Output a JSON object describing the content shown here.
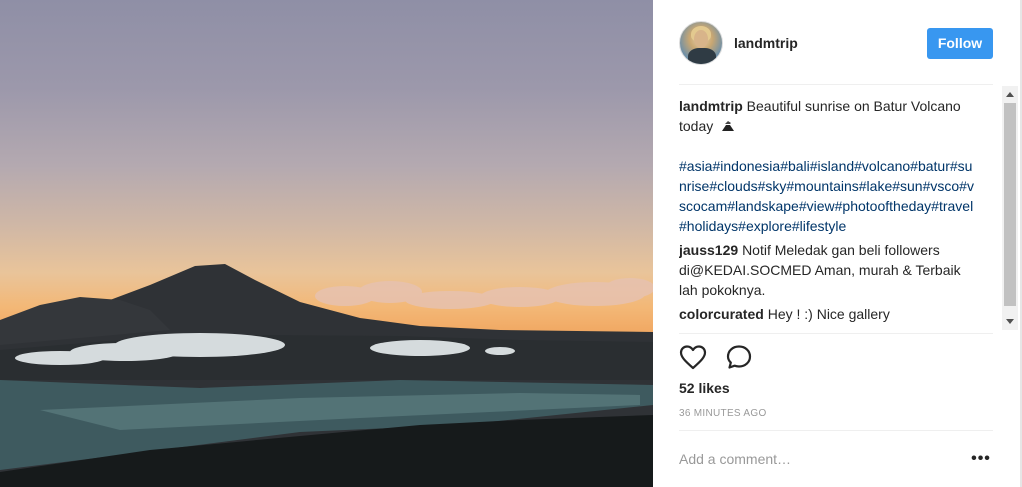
{
  "post": {
    "username": "landmtrip",
    "follow_label": "Follow",
    "caption_user": "landmtrip",
    "caption_text": "Beautiful sunrise on Batur Volcano today",
    "hashtags": "#asia#indonesia#bali#island#volcano#batur#sunrise#clouds#sky#mountains#lake#sun#vsco#vscocam#landskape#view#photooftheday#travel#holidays#explore#lifestyle",
    "comments": [
      {
        "user": "jauss129",
        "text": "Notif Meledak gan beli followers di@KEDAI.SOCMED Aman, murah & Terbaik lah pokoknya."
      },
      {
        "user": "colorcurated",
        "text": "Hey ! :) Nice gallery"
      }
    ],
    "likes": "52 likes",
    "timestamp": "36 MINUTES AGO",
    "add_comment_placeholder": "Add a comment…",
    "more_label": "•••"
  },
  "icons": {
    "like": "heart-icon",
    "comment": "comment-bubble-icon",
    "caption_emoji": "volcano-emoji-icon"
  },
  "colors": {
    "follow_button": "#3897f0",
    "hashtag": "#003569",
    "timestamp": "#999999"
  }
}
